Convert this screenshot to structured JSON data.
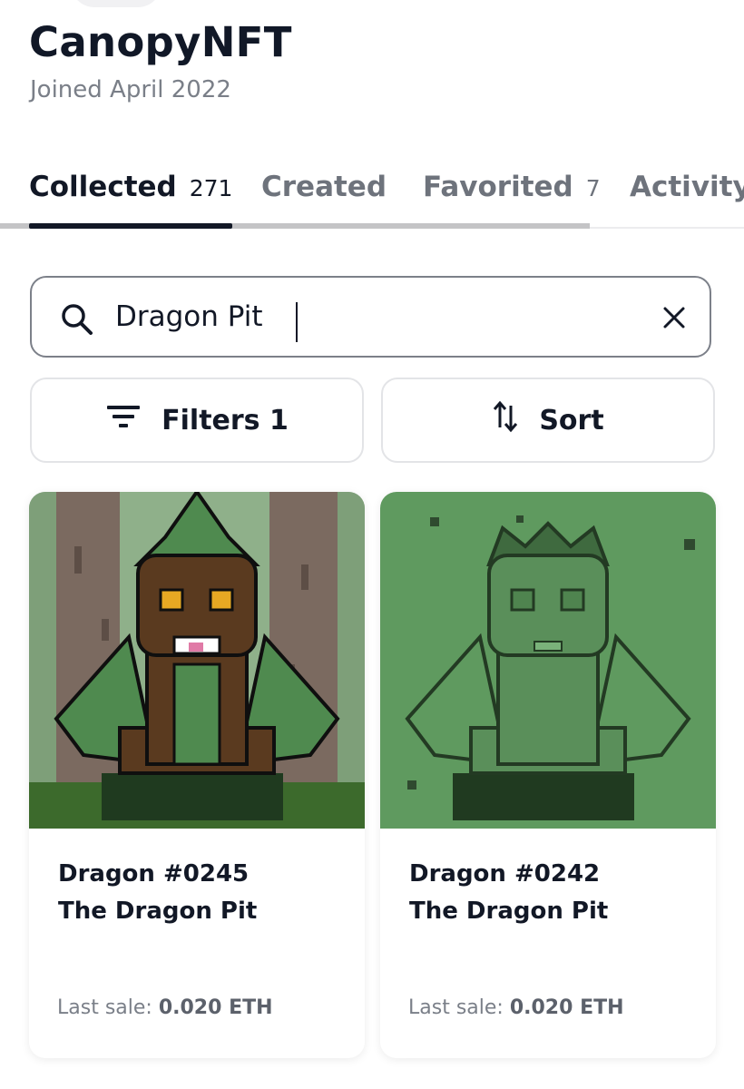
{
  "profile": {
    "name": "CanopyNFT",
    "joined": "Joined April 2022"
  },
  "tabs": [
    {
      "label": "Collected",
      "count": "271",
      "active": true
    },
    {
      "label": "Created",
      "count": "",
      "active": false
    },
    {
      "label": "Favorited",
      "count": "7",
      "active": false
    },
    {
      "label": "Activity",
      "count": "",
      "active": false
    }
  ],
  "search": {
    "value": "Dragon Pit",
    "icon": "search-icon",
    "clear_icon": "close-icon"
  },
  "toolbar": {
    "filters_label": "Filters 1",
    "filters_icon": "filter-icon",
    "sort_label": "Sort",
    "sort_icon": "sort-arrows-icon"
  },
  "cards": [
    {
      "name": "Dragon #0245",
      "collection": "The Dragon Pit",
      "sale_label": "Last sale:",
      "sale_price": "0.020 ETH",
      "background": "#2f6b3a"
    },
    {
      "name": "Dragon #0242",
      "collection": "The Dragon Pit",
      "sale_label": "Last sale:",
      "sale_price": "0.020 ETH",
      "background": "#5f9a5f"
    }
  ],
  "colors": {
    "text_primary": "#121826",
    "text_muted": "#7a7f88",
    "tab_indicator": "#121826",
    "border": "#7c8089"
  }
}
